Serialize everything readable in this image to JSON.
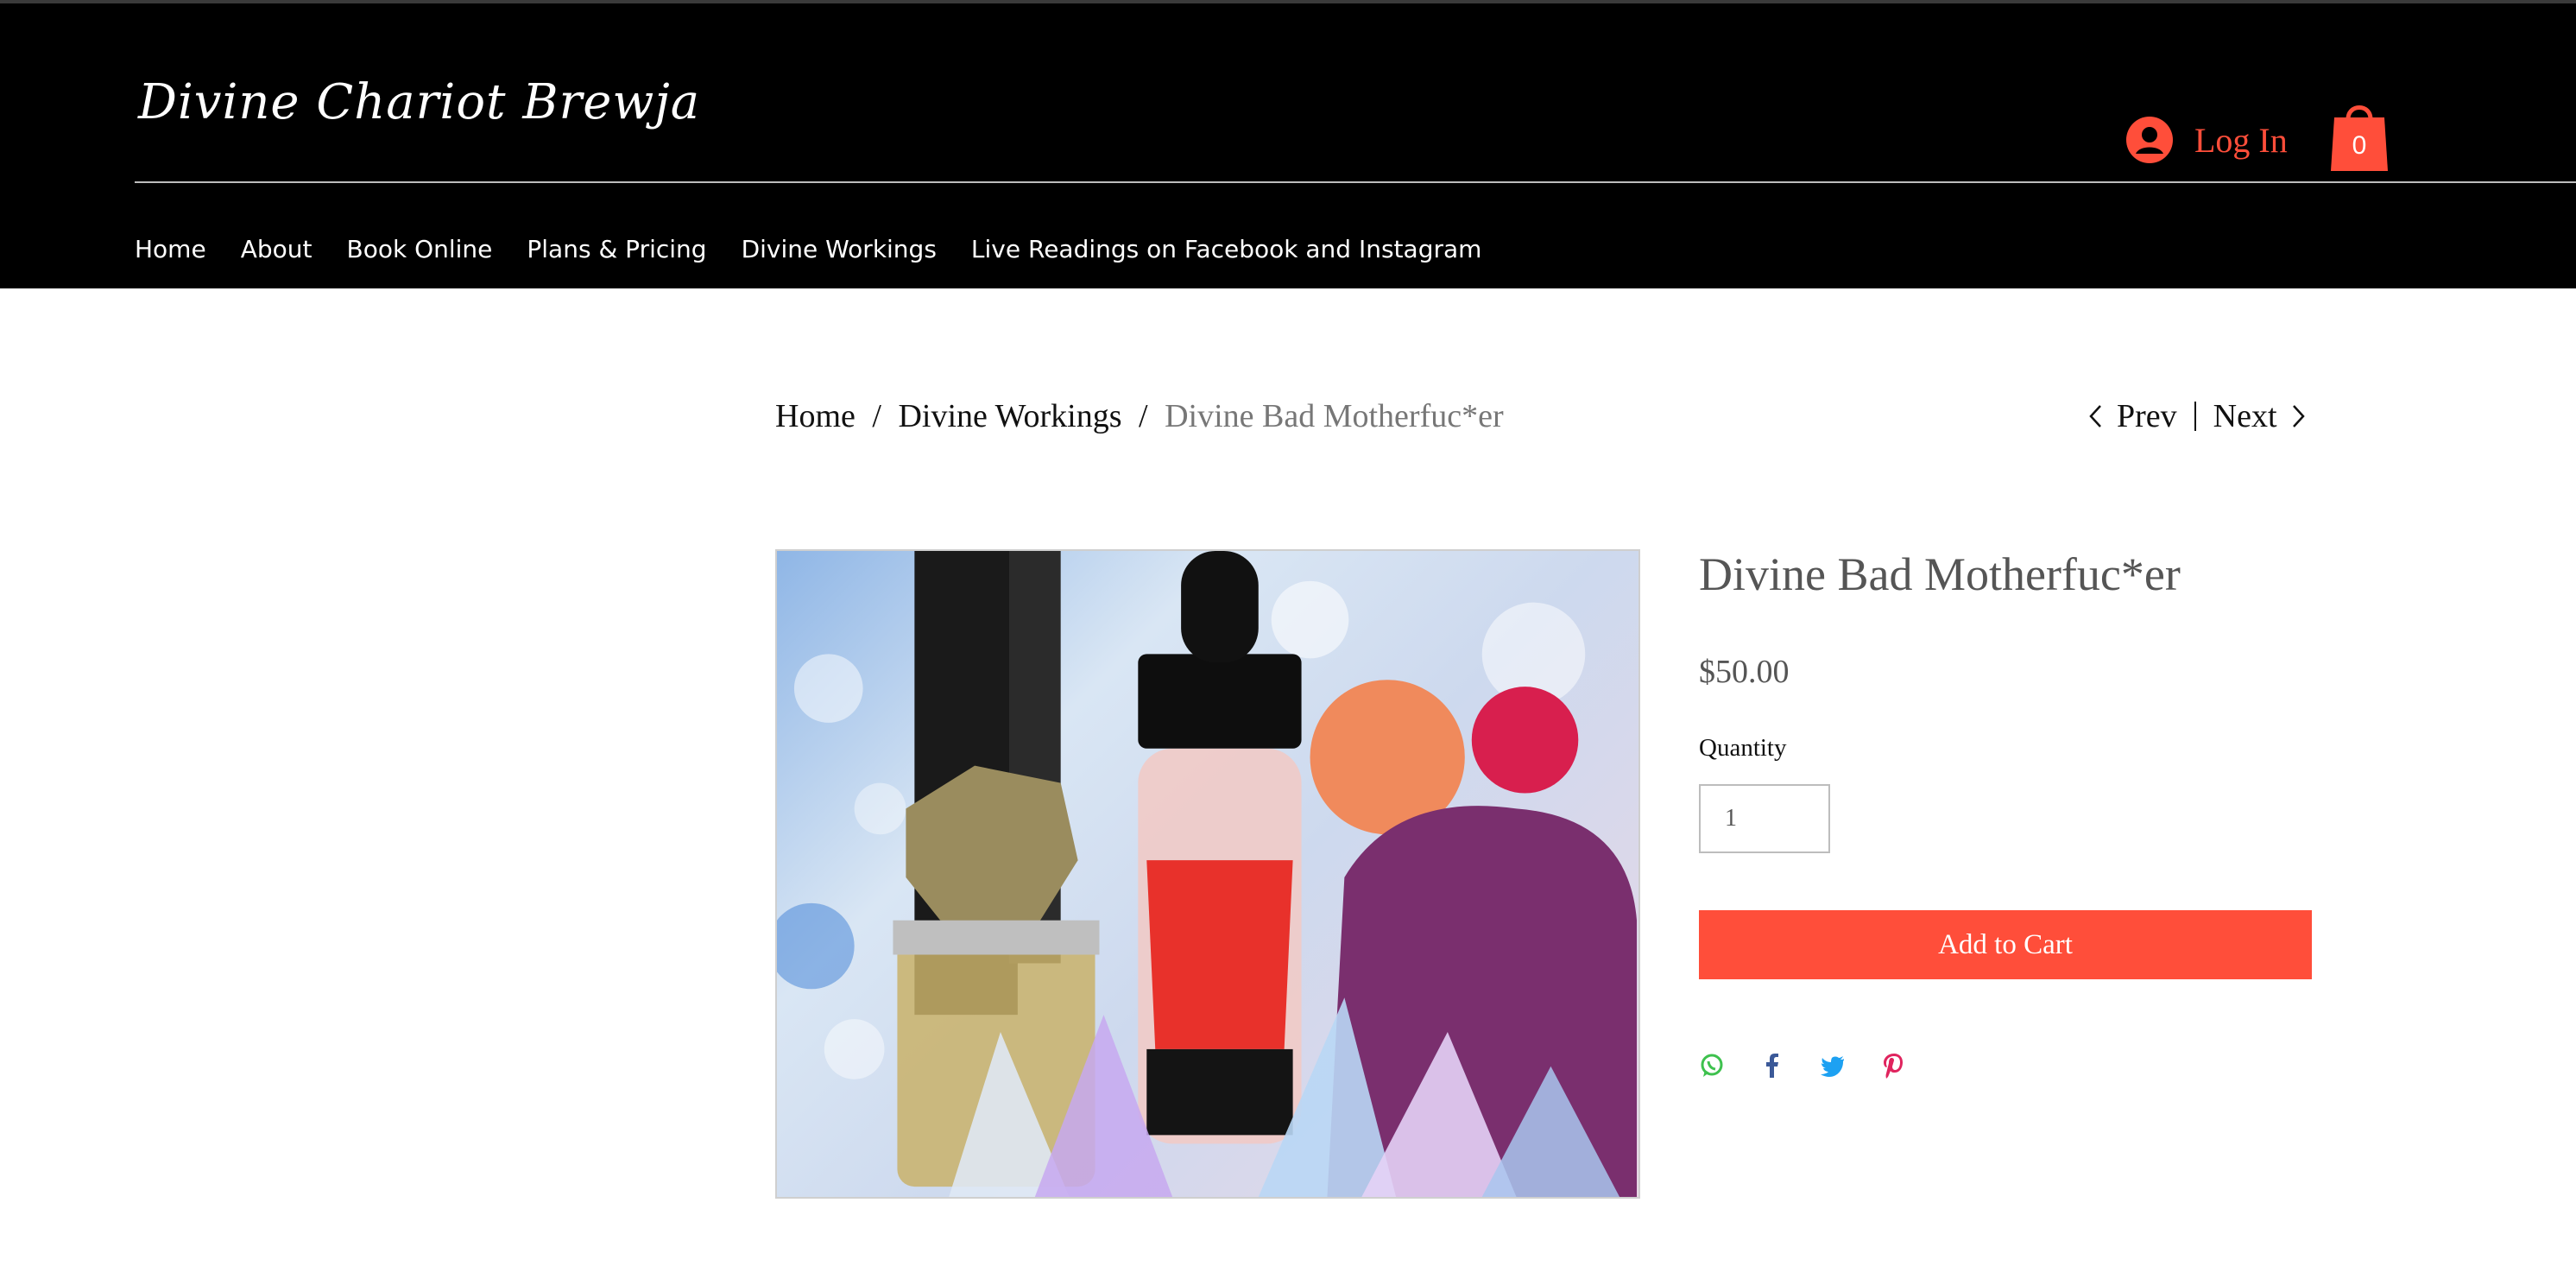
{
  "site": {
    "logo": "Divine Chariot Brewja",
    "login_label": "Log In",
    "cart_count": "0",
    "accent_color": "#ff4e3a"
  },
  "nav": {
    "items": [
      {
        "label": "Home"
      },
      {
        "label": "About"
      },
      {
        "label": "Book Online"
      },
      {
        "label": "Plans & Pricing"
      },
      {
        "label": "Divine Workings"
      },
      {
        "label": "Live Readings on Facebook and Instagram"
      }
    ]
  },
  "breadcrumb": {
    "home": "Home",
    "separator": "/",
    "category": "Divine Workings",
    "current": "Divine Bad Motherfuc*er"
  },
  "pager": {
    "prev": "Prev",
    "next": "Next"
  },
  "product": {
    "title": "Divine Bad Motherfuc*er",
    "price": "$50.00",
    "quantity_label": "Quantity",
    "quantity_value": "1",
    "add_to_cart": "Add to Cart",
    "image_icon": "product-photo-dropper-bottle-crystals"
  },
  "share": {
    "icons": [
      "whatsapp-icon",
      "facebook-icon",
      "twitter-icon",
      "pinterest-icon"
    ],
    "colors": [
      "#3ec14e",
      "#3b5998",
      "#1da1f2",
      "#e0245e"
    ]
  }
}
